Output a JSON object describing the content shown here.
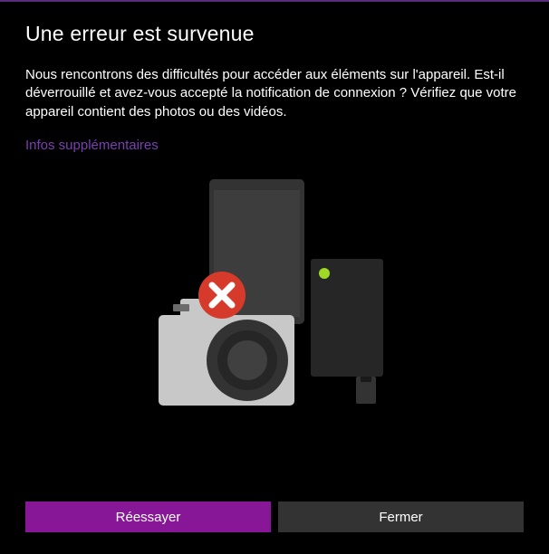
{
  "title": "Une erreur est survenue",
  "description": "Nous rencontrons des difficultés pour accéder aux éléments sur l'appareil. Est-il déverrouillé et avez-vous accepté la notification de connexion ? Vérifiez que votre appareil contient des photos ou des vidéos.",
  "link_label": "Infos supplémentaires",
  "buttons": {
    "retry": "Réessayer",
    "close": "Fermer"
  }
}
